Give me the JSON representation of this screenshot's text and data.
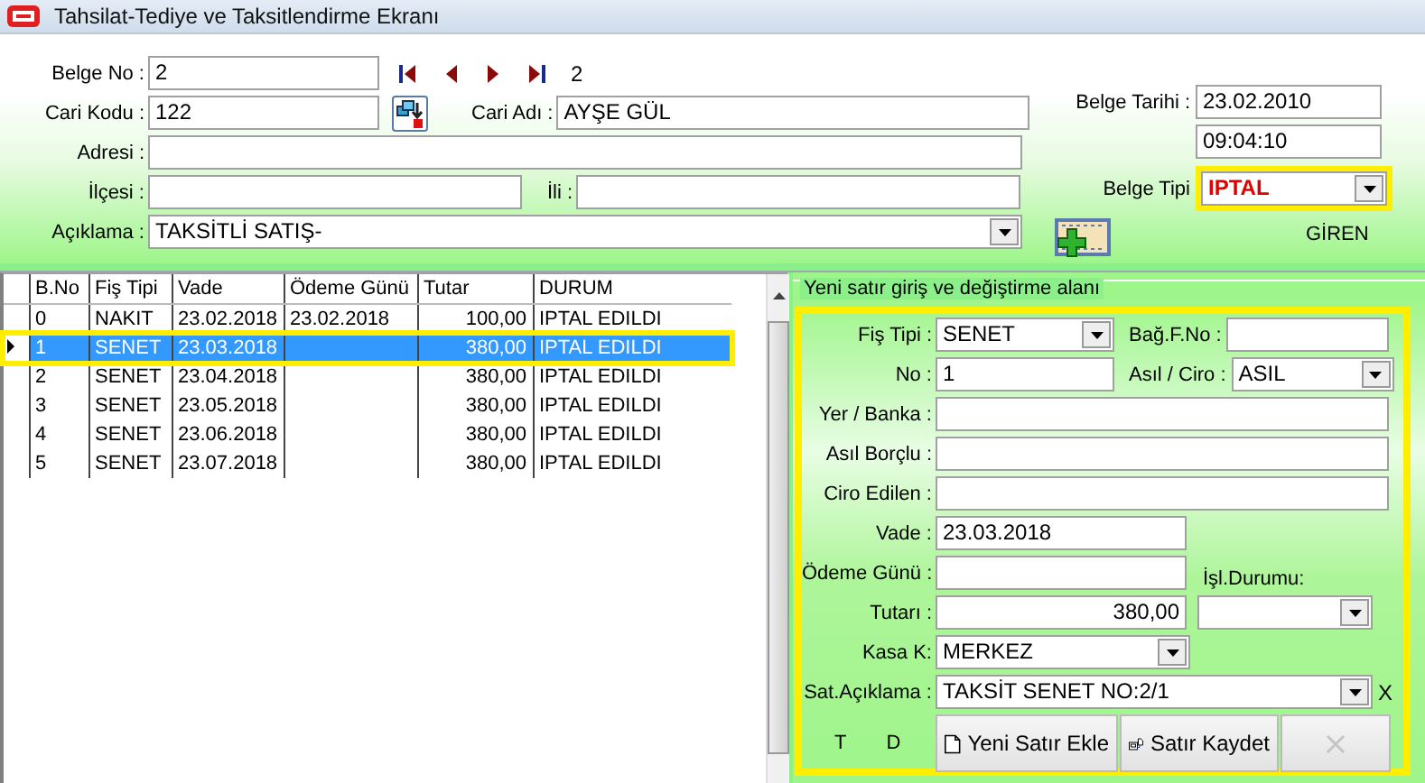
{
  "window": {
    "title": "Tahsilat-Tediye ve Taksitlendirme Ekranı"
  },
  "header": {
    "belge_no": {
      "label": "Belge No :",
      "value": "2"
    },
    "navigator": {
      "record": "2"
    },
    "cari_kodu": {
      "label": "Cari Kodu :",
      "value": "122"
    },
    "cari_adi": {
      "label": "Cari Adı :",
      "value": "AYŞE GÜL"
    },
    "adresi": {
      "label": "Adresi :"
    },
    "ilcesi": {
      "label": "İlçesi :"
    },
    "ili": {
      "label": "İli :"
    },
    "aciklama": {
      "label": "Açıklama :",
      "value": "TAKSİTLİ SATIŞ-"
    },
    "belge_tarihi": {
      "label": "Belge Tarihi :",
      "value": "23.02.2010"
    },
    "saat": {
      "value": "09:04:10"
    },
    "belge_tipi": {
      "label": "Belge Tipi",
      "value": "IPTAL",
      "highlighted": true
    },
    "giren": "GİREN"
  },
  "grid": {
    "columns": [
      "B.No",
      "Fiş Tipi",
      "Vade",
      "Ödeme Günü",
      "Tutar",
      "DURUM"
    ],
    "rows": [
      {
        "cells": [
          "0",
          "NAKIT",
          "23.02.2018",
          "23.02.2018",
          "100,00",
          "IPTAL EDILDI"
        ],
        "selected": false
      },
      {
        "cells": [
          "1",
          "SENET",
          "23.03.2018",
          "",
          "380,00",
          "IPTAL EDILDI"
        ],
        "selected": true
      },
      {
        "cells": [
          "2",
          "SENET",
          "23.04.2018",
          "",
          "380,00",
          "IPTAL EDILDI"
        ],
        "selected": false
      },
      {
        "cells": [
          "3",
          "SENET",
          "23.05.2018",
          "",
          "380,00",
          "IPTAL EDILDI"
        ],
        "selected": false
      },
      {
        "cells": [
          "4",
          "SENET",
          "23.06.2018",
          "",
          "380,00",
          "IPTAL EDILDI"
        ],
        "selected": false
      },
      {
        "cells": [
          "5",
          "SENET",
          "23.07.2018",
          "",
          "380,00",
          "IPTAL EDILDI"
        ],
        "selected": false
      }
    ]
  },
  "entry": {
    "title": "Yeni satır giriş ve değiştirme alanı",
    "highlighted": true,
    "fis_tipi": {
      "label": "Fiş Tipi :",
      "value": "SENET"
    },
    "bag_f_no": {
      "label": "Bağ.F.No :"
    },
    "no": {
      "label": "No :",
      "value": "1"
    },
    "asil_ciro": {
      "label": "Asıl / Ciro :",
      "value": "ASIL"
    },
    "yer_banka": {
      "label": "Yer / Banka :"
    },
    "asil_borclu": {
      "label": "Asıl Borçlu :"
    },
    "ciro_edilen": {
      "label": "Ciro Edilen :"
    },
    "vade": {
      "label": "Vade :",
      "value": "23.03.2018"
    },
    "odeme_gunu": {
      "label": "Ödeme Günü :"
    },
    "isl_durumu": {
      "label": "İşl.Durumu:"
    },
    "tutari": {
      "label": "Tutarı :",
      "value": "380,00"
    },
    "kasa": {
      "label": "Kasa K:",
      "value": "MERKEZ"
    },
    "sat_aciklama": {
      "label": "Sat.Açıklama :",
      "value": "TAKSİT SENET NO:2/1"
    },
    "clear_mark": "X",
    "totals": [
      "T",
      "D"
    ],
    "buttons": [
      {
        "kind": "new",
        "label": "Yeni Satır Ekle",
        "disabled": false
      },
      {
        "kind": "save",
        "label": "Satır Kaydet",
        "disabled": false
      },
      {
        "kind": "delete",
        "disabled": true
      }
    ]
  }
}
